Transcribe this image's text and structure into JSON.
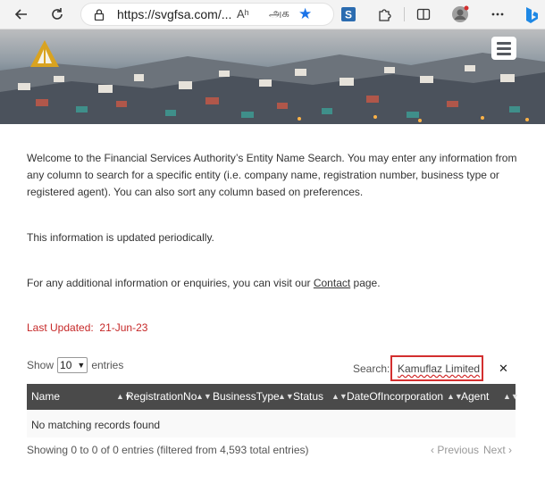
{
  "browser": {
    "url": "https://svgfsa.com/...",
    "read_aloud": "Aʰ",
    "translate": "அக"
  },
  "content": {
    "intro": "Welcome to the Financial Services Authority’s Entity Name Search. You may enter any information from any column to search for a specific entity (i.e. company name, registration number, business type or registered agent). You can also sort any column based on preferences.",
    "updated_note": "This information is updated periodically.",
    "contact_prefix": "For any additional information or enquiries, you can visit our ",
    "contact_link": "Contact",
    "contact_suffix": " page.",
    "last_updated_label": "Last Updated:",
    "last_updated_value": "21-Jun-23"
  },
  "table_controls": {
    "show_label": "Show",
    "show_value": "10",
    "entries_label": "entries",
    "search_label": "Search:",
    "search_value": "Kamuflaz Limited",
    "clear_symbol": "✕"
  },
  "table": {
    "columns": [
      "Name",
      "RegistrationNo",
      "BusinessType",
      "Status",
      "DateOfIncorporation",
      "Agent"
    ],
    "empty_message": "No matching records found"
  },
  "footer": {
    "info": "Showing 0 to 0 of 0 entries (filtered from 4,593 total entries)",
    "prev": "‹ Previous",
    "next": "Next ›"
  },
  "colors": {
    "accent_red": "#d32f2f",
    "table_header": "#4a4a4a",
    "star_blue": "#1a73e8"
  }
}
